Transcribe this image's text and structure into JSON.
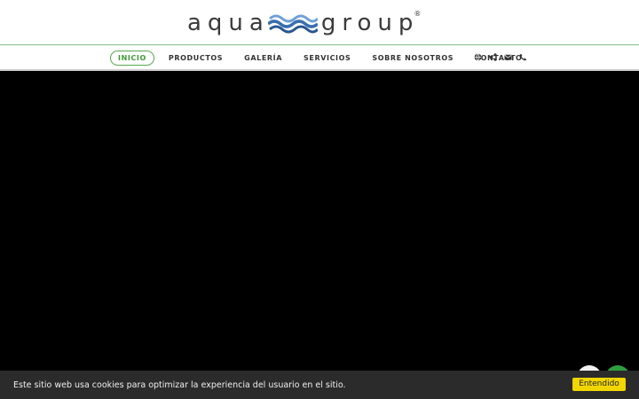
{
  "logo": {
    "left_text": "aqua",
    "right_text": "group",
    "reg_mark": "®",
    "wave_color": "#3a6fb0"
  },
  "nav": {
    "items": [
      {
        "label": "INICIO",
        "active": true
      },
      {
        "label": "PRODUCTOS",
        "active": false
      },
      {
        "label": "GALERÍA",
        "active": false
      },
      {
        "label": "SERVICIOS",
        "active": false
      },
      {
        "label": "SOBRE NOSOTROS",
        "active": false
      },
      {
        "label": "CONTACTO",
        "active": false
      }
    ],
    "icons": [
      "globe-icon",
      "share-icon",
      "envelope-icon",
      "phone-icon"
    ],
    "accent_color": "#58a94e"
  },
  "cookie": {
    "message": "Este sitio web usa cookies para optimizar la experiencia del usuario en el sitio.",
    "button_label": "Entendido",
    "button_color": "#f1d600"
  }
}
